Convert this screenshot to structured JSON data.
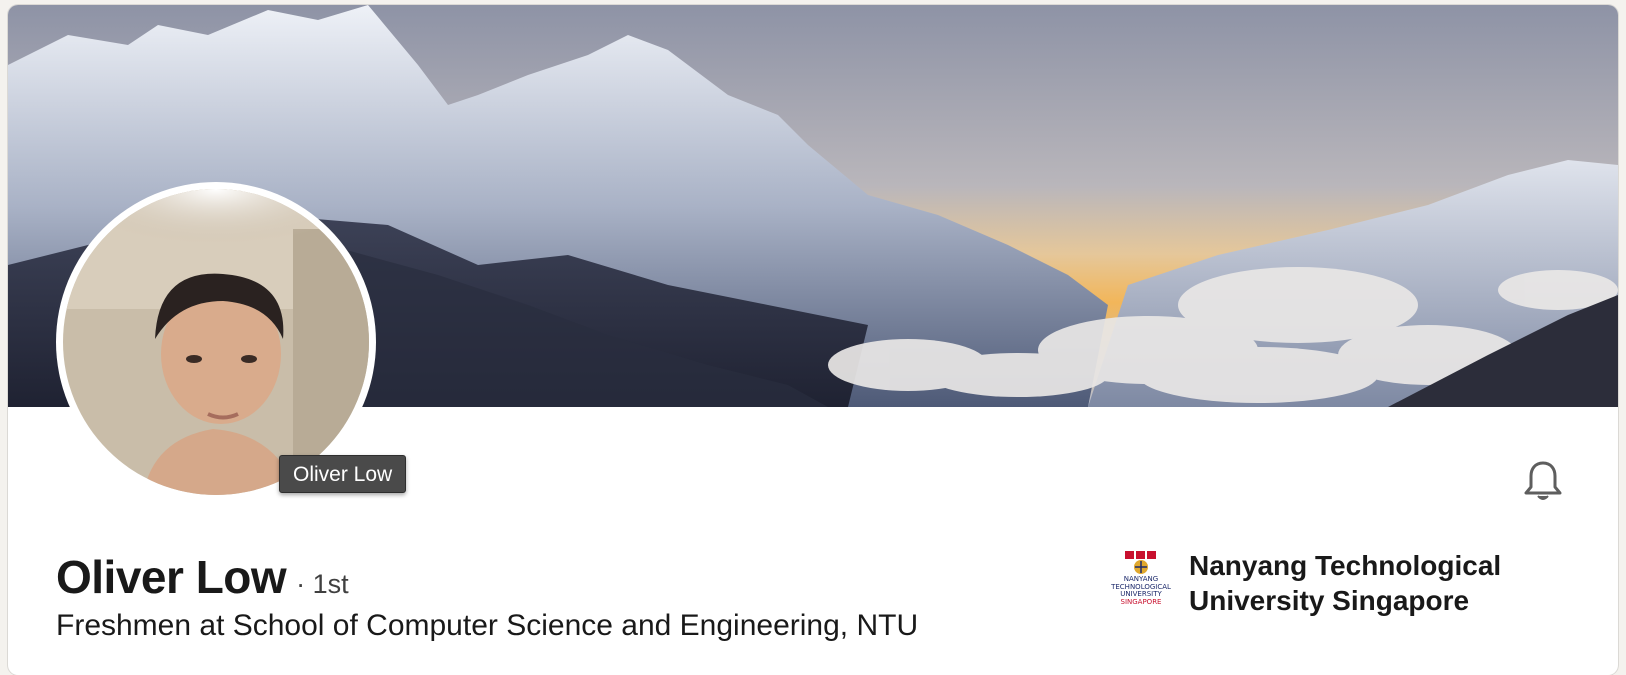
{
  "profile": {
    "name": "Oliver Low",
    "degree": "· 1st",
    "headline": "Freshmen at School of Computer Science and Engineering, NTU",
    "avatar_tooltip": "Oliver Low"
  },
  "education": {
    "school_name": "Nanyang Technological University Singapore",
    "logo_text": [
      "NANYANG",
      "TECHNOLOGICAL",
      "UNIVERSITY",
      "SINGAPORE"
    ]
  },
  "icons": {
    "notify": "bell-icon",
    "logo": "ntu-logo"
  },
  "colors": {
    "text_primary": "#191919",
    "ntu_blue": "#1d2a6b",
    "ntu_red": "#c8102e"
  }
}
